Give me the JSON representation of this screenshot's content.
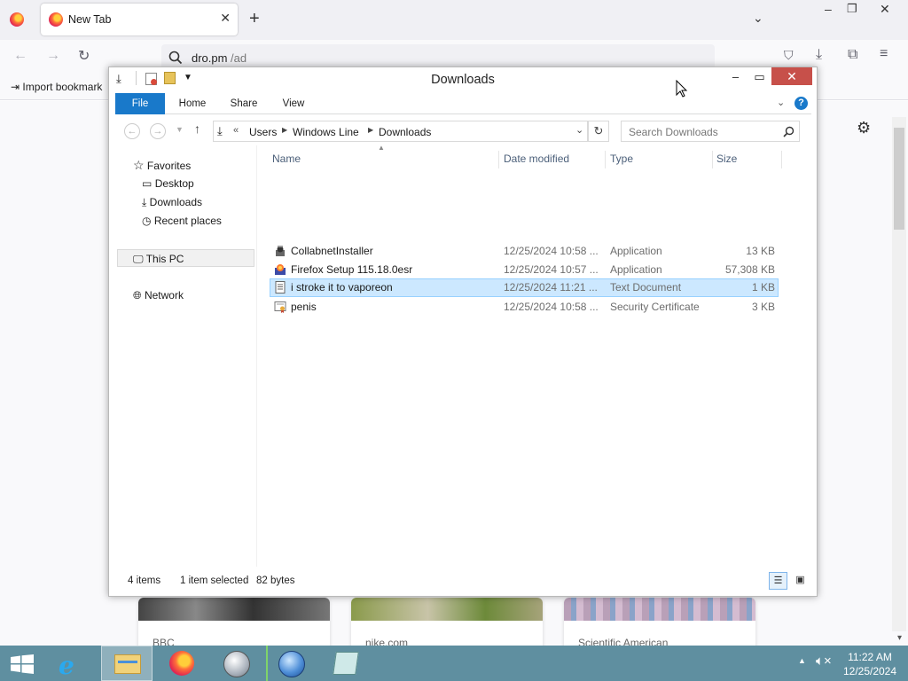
{
  "browser": {
    "tab_title": "New Tab",
    "url_host": "dro.pm",
    "url_path": "/ad",
    "bookmark_label": "Import bookmark",
    "newtab_cards": [
      "BBC",
      "nike.com",
      "Scientific American"
    ]
  },
  "explorer": {
    "title": "Downloads",
    "ribbon_tabs": [
      "File",
      "Home",
      "Share",
      "View"
    ],
    "breadcrumb": [
      "Users",
      "Windows Line",
      "Downloads"
    ],
    "breadcrumb_prefix": "«",
    "search_placeholder": "Search Downloads",
    "nav": {
      "favorites": "Favorites",
      "desktop": "Desktop",
      "downloads": "Downloads",
      "recent": "Recent places",
      "this_pc": "This PC",
      "network": "Network"
    },
    "columns": {
      "name": "Name",
      "date": "Date modified",
      "type": "Type",
      "size": "Size"
    },
    "files": [
      {
        "name": "CollabnetInstaller",
        "date": "12/25/2024 10:58 ...",
        "type": "Application",
        "size": "13 KB",
        "icon": "installer-icon"
      },
      {
        "name": "Firefox Setup 115.18.0esr",
        "date": "12/25/2024 10:57 ...",
        "type": "Application",
        "size": "57,308 KB",
        "icon": "firefox-setup-icon"
      },
      {
        "name": "i stroke it to vaporeon",
        "date": "12/25/2024 11:21 ...",
        "type": "Text Document",
        "size": "1 KB",
        "icon": "text-document-icon",
        "selected": true
      },
      {
        "name": "penis",
        "date": "12/25/2024 10:58 ...",
        "type": "Security Certificate",
        "size": "3 KB",
        "icon": "certificate-icon"
      }
    ],
    "status": {
      "items": "4 items",
      "selected": "1 item selected",
      "bytes": "82 bytes"
    }
  },
  "taskbar": {
    "time": "11:22 AM",
    "date": "12/25/2024"
  },
  "colors": {
    "accent": "#1979ca",
    "selection": "#cce8ff",
    "close": "#c7504a",
    "taskbar": "#5f8fa0"
  }
}
